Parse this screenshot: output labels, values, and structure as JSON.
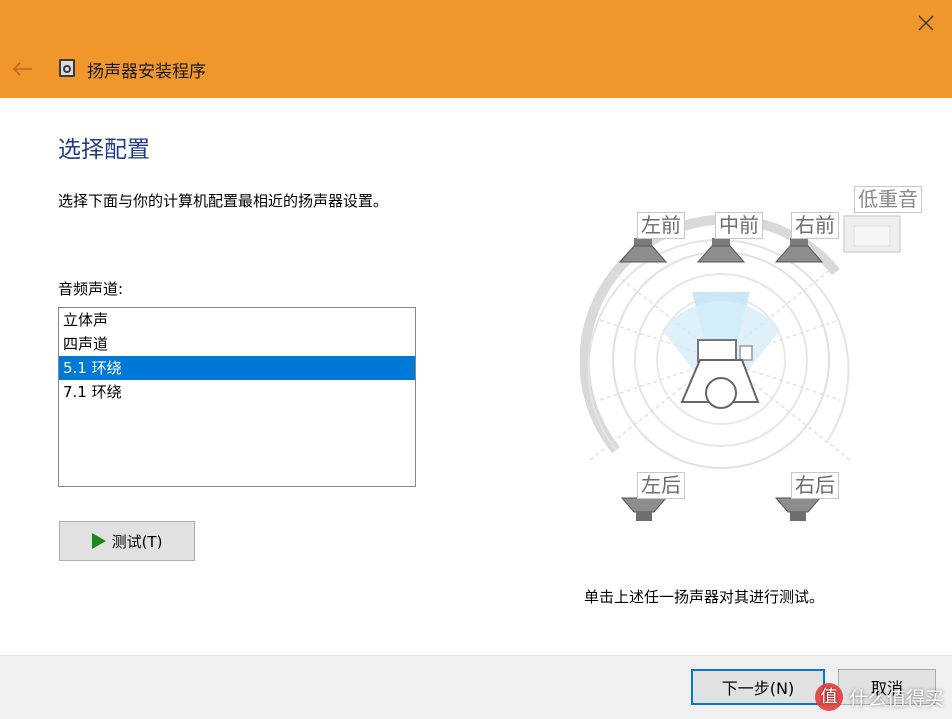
{
  "window": {
    "title": "扬声器安装程序",
    "accent_color": "#f0962b"
  },
  "icons": {
    "close": "close-icon",
    "back": "back-arrow-icon",
    "app": "speaker-app-icon",
    "play": "play-icon"
  },
  "page": {
    "heading": "选择配置",
    "description": "选择下面与你的计算机配置最相近的扬声器设置。",
    "list_label": "音频声道:",
    "instruction": "单击上述任一扬声器对其进行测试。"
  },
  "channels": {
    "items": [
      "立体声",
      "四声道",
      "5.1 环绕",
      "7.1 环绕"
    ],
    "selected": "5.1 环绕",
    "selected_color": "#0078d7"
  },
  "speakers": {
    "front_left": "左前",
    "front_center": "中前",
    "front_right": "右前",
    "subwoofer": "低重音",
    "rear_left": "左后",
    "rear_right": "右后"
  },
  "buttons": {
    "test": "测试(T)",
    "next": "下一步(N)",
    "cancel": "取消"
  },
  "watermark": {
    "logo": "值",
    "text": "什么值得买"
  }
}
